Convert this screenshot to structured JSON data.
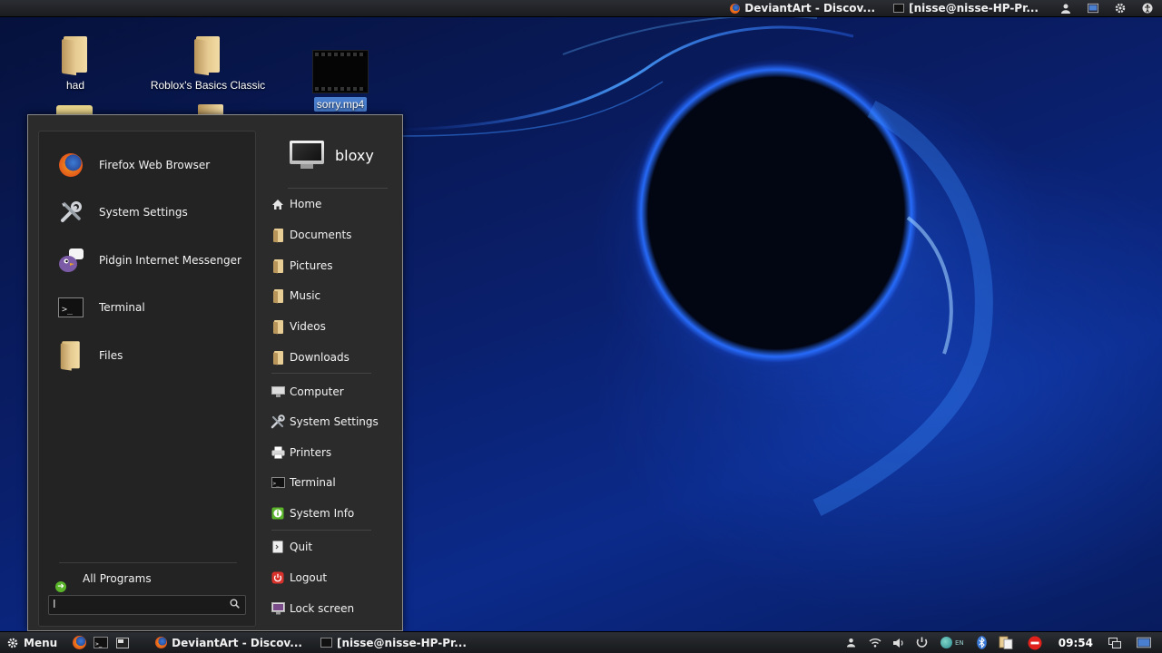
{
  "top_panel": {
    "tasks": [
      {
        "label": "DeviantArt - Discov...",
        "icon": "firefox-icon"
      },
      {
        "label": "[nisse@nisse-HP-Pr...",
        "icon": "terminal-icon"
      }
    ],
    "tray_icons": [
      "user-icon",
      "screen-icon",
      "settings-icon",
      "accessibility-icon"
    ]
  },
  "desktop": {
    "icons": [
      {
        "label": "had",
        "type": "folder"
      },
      {
        "label": "Roblox's Basics Classic",
        "type": "folder"
      },
      {
        "label": "sorry.mp4",
        "type": "video",
        "selected": true
      }
    ]
  },
  "menu": {
    "favorites": [
      {
        "label": "Firefox Web Browser",
        "icon": "firefox-icon"
      },
      {
        "label": "System Settings",
        "icon": "tools-icon"
      },
      {
        "label": "Pidgin Internet Messenger",
        "icon": "pidgin-icon"
      },
      {
        "label": "Terminal",
        "icon": "terminal-icon"
      },
      {
        "label": "Files",
        "icon": "folder-icon"
      }
    ],
    "all_programs": "All Programs",
    "search_value": "I",
    "user": "bloxy",
    "places": [
      {
        "label": "Home",
        "icon": "home-icon"
      },
      {
        "label": "Documents",
        "icon": "folder-icon"
      },
      {
        "label": "Pictures",
        "icon": "folder-icon"
      },
      {
        "label": "Music",
        "icon": "folder-icon"
      },
      {
        "label": "Videos",
        "icon": "folder-icon"
      },
      {
        "label": "Downloads",
        "icon": "folder-icon"
      }
    ],
    "system": [
      {
        "label": "Computer",
        "icon": "computer-icon"
      },
      {
        "label": "System Settings",
        "icon": "tools-icon"
      },
      {
        "label": "Printers",
        "icon": "printer-icon"
      },
      {
        "label": "Terminal",
        "icon": "terminal-icon"
      },
      {
        "label": "System Info",
        "icon": "info-icon"
      }
    ],
    "session": [
      {
        "label": "Quit",
        "icon": "quit-icon"
      },
      {
        "label": "Logout",
        "icon": "logout-icon"
      },
      {
        "label": "Lock screen",
        "icon": "lock-screen-icon"
      }
    ]
  },
  "bottom_panel": {
    "menu_label": "Menu",
    "launchers": [
      "firefox-icon",
      "terminal-icon",
      "show-desktop-icon"
    ],
    "tasks": [
      {
        "label": "DeviantArt - Discov...",
        "icon": "firefox-icon"
      },
      {
        "label": "[nisse@nisse-HP-Pr...",
        "icon": "terminal-icon"
      }
    ],
    "keyboard_layout": "EN",
    "clock": "09:54"
  },
  "colors": {
    "panel": "#1f2124",
    "menu_bg": "#2b2b2b",
    "selection": "#4a7fd0",
    "accent_blue": "#2a6cff"
  }
}
